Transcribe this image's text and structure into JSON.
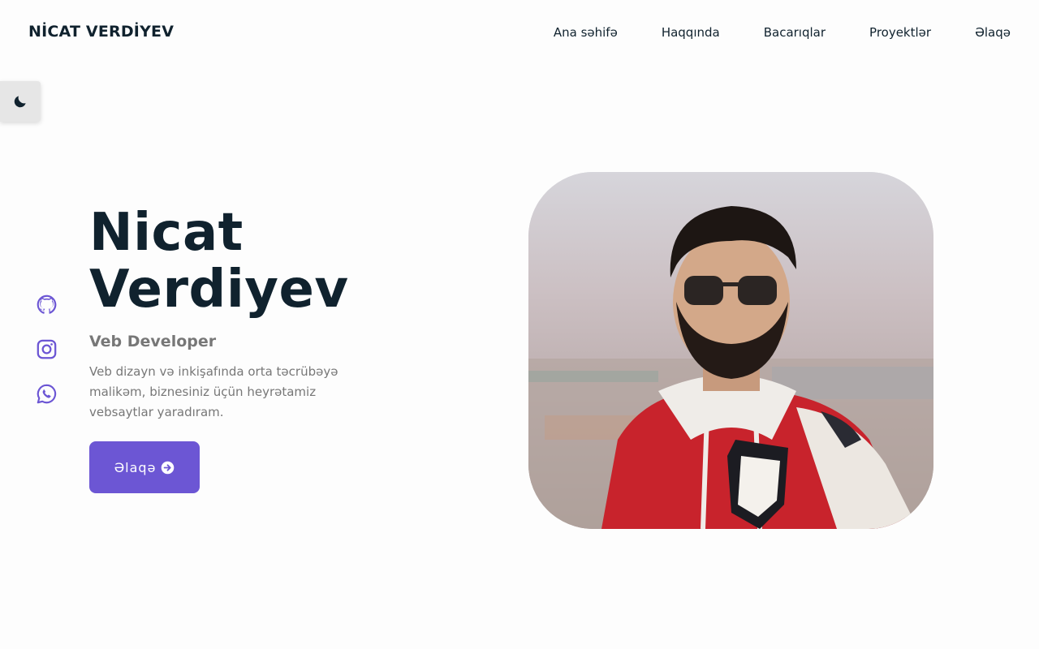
{
  "header": {
    "logo": "NİCAT VERDİYEV",
    "nav": [
      "Ana səhifə",
      "Haqqında",
      "Bacarıqlar",
      "Proyektlər",
      "Əlaqə"
    ]
  },
  "theme_toggle": {
    "icon": "moon-icon"
  },
  "social_links": [
    {
      "icon": "github-icon"
    },
    {
      "icon": "instagram-icon"
    },
    {
      "icon": "whatsapp-icon"
    }
  ],
  "hero": {
    "name_line1": "Nicat",
    "name_line2": "Verdiyev",
    "role": "Veb Developer",
    "description": "Veb dizayn və inkişafında orta təcrübəyə malikəm, biznesiniz üçün heyrətamiz vebsaytlar yaradıram.",
    "cta_label": "Əlaqə",
    "cta_icon": "arrow-right-circle-icon"
  },
  "colors": {
    "accent": "#6c56d4",
    "heading": "#10222e",
    "muted_text": "#777777",
    "toggle_bg": "#e6e6e6"
  }
}
